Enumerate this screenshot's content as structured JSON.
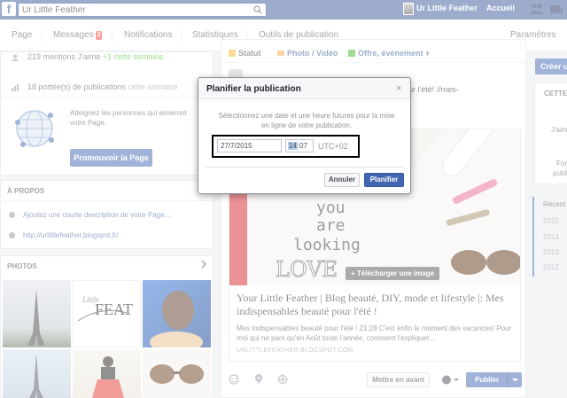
{
  "topbar": {
    "search_value": "Ur Little Feather",
    "profile_name": "Ur Little Feather",
    "home_label": "Accueil"
  },
  "page_tabs": {
    "page": "Page",
    "messages": "Messages",
    "messages_badge": "2",
    "notifications": "Notifications",
    "statistics": "Statistiques",
    "publishing_tools": "Outils de publication",
    "settings": "Paramètres"
  },
  "stats": {
    "likes": "219 mentions J'aime",
    "likes_delta": "+1 cette semaine",
    "reach": "18 portée(s) de publications",
    "reach_period": "cette semaine"
  },
  "promo": {
    "text": "Atteignez les personnes qui aimeront votre Page.",
    "button": "Promouvoir la Page"
  },
  "about": {
    "title": "À PROPOS",
    "add_description": "Ajoutez une courte description de votre Page...",
    "website": "http://urlittlefeather.blogspot.fr/"
  },
  "photos": {
    "title": "PHOTOS"
  },
  "composer": {
    "status": "Statut",
    "photo_video": "Photo / Vidéo",
    "offer_event": "Offre, évènement +"
  },
  "post": {
    "text": "sensables beauté pour l'été! //mes-indispensables-",
    "upload_image": "Télécharger une image",
    "image_text": [
      "you",
      "are",
      "looking",
      "LOVE"
    ],
    "link_title": "Your Little Feather | Blog beauté, DIY, mode et lifestyle |: Mes indispensables beauté pour l'été !",
    "link_desc": "Mes indispensables beauté pour l'été ! 21:28 C'est enfin le moment des vacances! Pour moi qui ne pars qu'en Août toute l'année, comment l'expliquer...",
    "link_domain": "URLITTLEFEATHER.BLOGSPOT.COM",
    "boost_button": "Mettre en avant",
    "publish_button": "Publier"
  },
  "right": {
    "create_button": "Créer u",
    "cette": "CETTE",
    "jaim": "J'aim",
    "for": "For",
    "publi": "publi",
    "recent": "Récent",
    "years": [
      "2015",
      "2014",
      "2013",
      "2012"
    ]
  },
  "modal": {
    "title": "Planifier la publication",
    "close": "×",
    "message": "Sélectionnez une date et une heure futures pour la mise en ligne de votre publication.",
    "date_value": "27/7/2015",
    "time_hours": "14",
    "time_minutes": "07",
    "timezone": "UTC+02",
    "cancel": "Annuler",
    "schedule": "Planifier"
  },
  "colors": {
    "brand_blue": "#3b5998",
    "button_blue": "#4267b2",
    "badge_red": "#fa3e3e",
    "positive_green": "#42b72a"
  }
}
